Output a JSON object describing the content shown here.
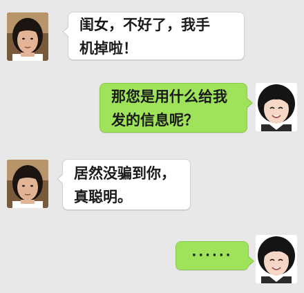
{
  "messages": [
    {
      "sender": "mother",
      "side": "left",
      "text": "闺女，不好了，我手\n机掉啦！"
    },
    {
      "sender": "daughter",
      "side": "right",
      "text": "那您是用什么给我\n发的信息呢？"
    },
    {
      "sender": "mother",
      "side": "left",
      "text": "居然没骗到你，\n真聪明。"
    },
    {
      "sender": "daughter",
      "side": "right",
      "text": "······"
    }
  ],
  "colors": {
    "background": "#e8e8e8",
    "incoming_bubble": "#ffffff",
    "outgoing_bubble": "#9fe35b"
  },
  "icons": {
    "mother_avatar": "mother-avatar-icon",
    "daughter_avatar": "daughter-avatar-icon"
  }
}
